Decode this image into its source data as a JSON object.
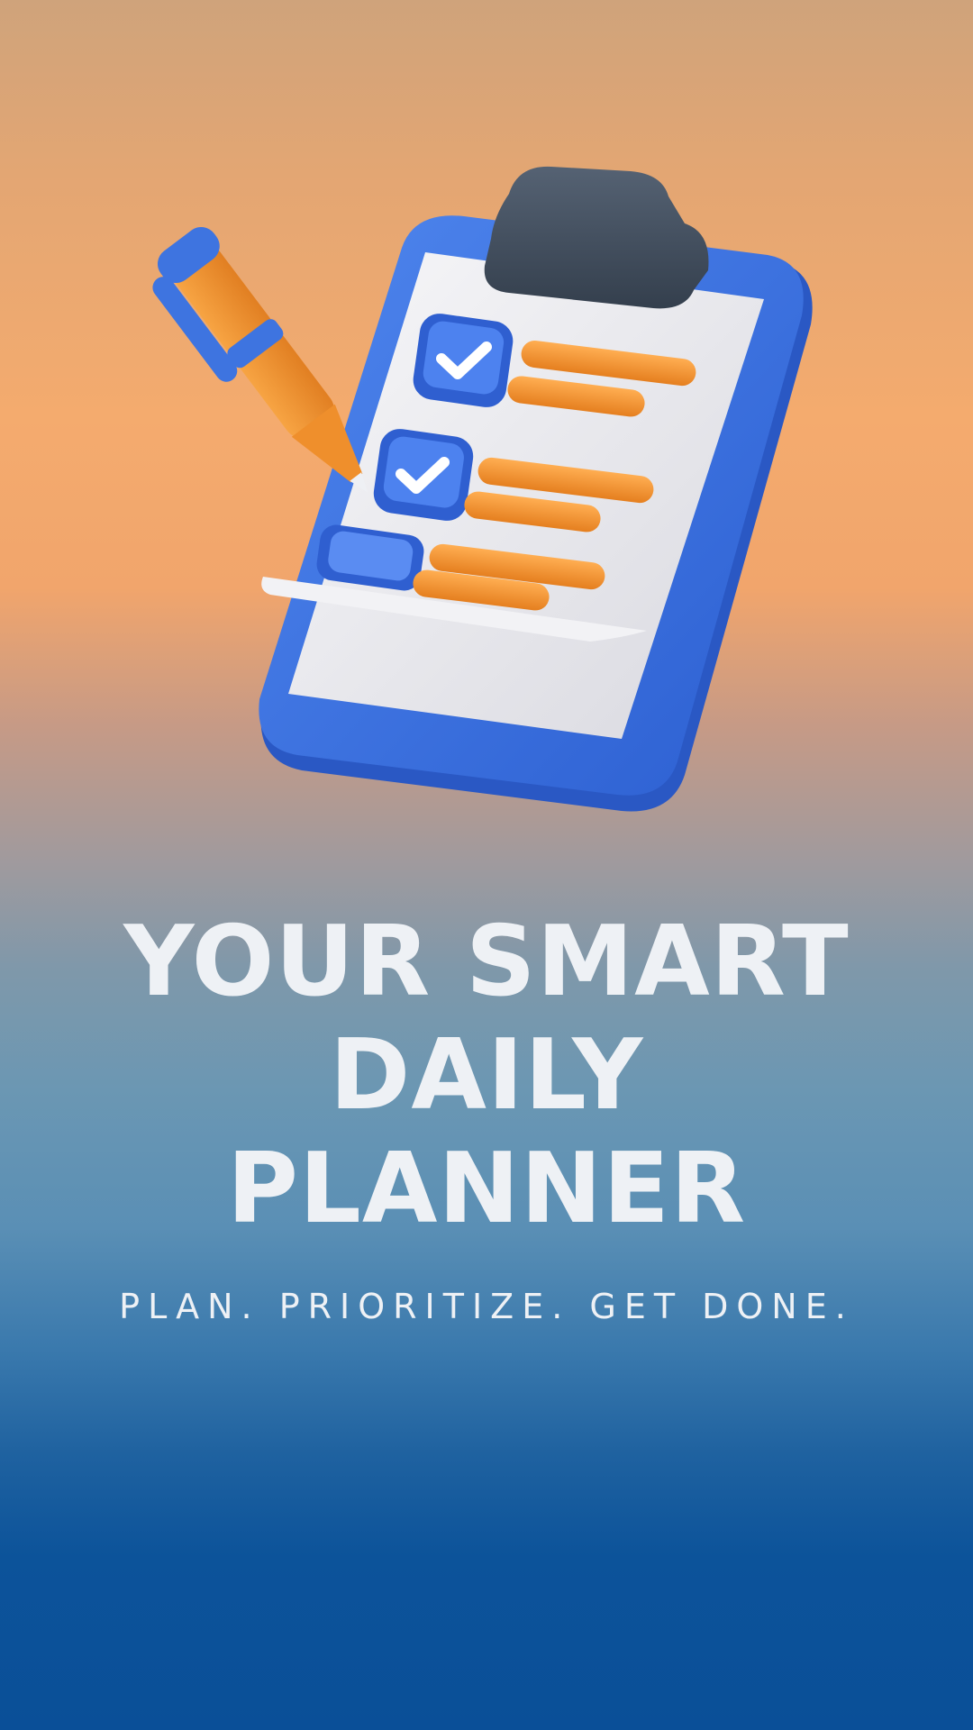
{
  "hero": {
    "illustration": "clipboard-checklist-with-pen",
    "checklist": [
      {
        "checked": true
      },
      {
        "checked": true
      },
      {
        "checked": false
      }
    ]
  },
  "headline": {
    "line1": "YOUR SMART",
    "line2": "DAILY",
    "line3": "PLANNER"
  },
  "tagline": "PLAN. PRIORITIZE. GET DONE.",
  "colors": {
    "text": "#eef1f5",
    "clipboard_blue": "#3b71de",
    "accent_orange": "#f0902c",
    "clip_dark": "#3e4a59"
  }
}
